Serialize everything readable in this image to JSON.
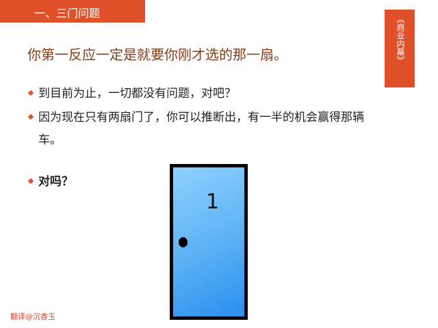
{
  "header": {
    "section_title": "一、三门问题"
  },
  "side_tab": {
    "label": "《商业内幕》"
  },
  "slide": {
    "title": "你第一反应一定是就要你刚才选的那一扇。",
    "bullets": [
      {
        "text": "到目前为止，一切都没有问题，对吧？"
      },
      {
        "text": "因为现在只有两扇门了，你可以推断出，有一半的机会赢得那辆车。"
      },
      {
        "text": "对吗？"
      }
    ],
    "door": {
      "number": "1"
    }
  },
  "watermark": "翻译@沉香玉",
  "colors": {
    "accent": "#e0512b",
    "title": "#8a3a16",
    "door": "#5fb4f5"
  }
}
